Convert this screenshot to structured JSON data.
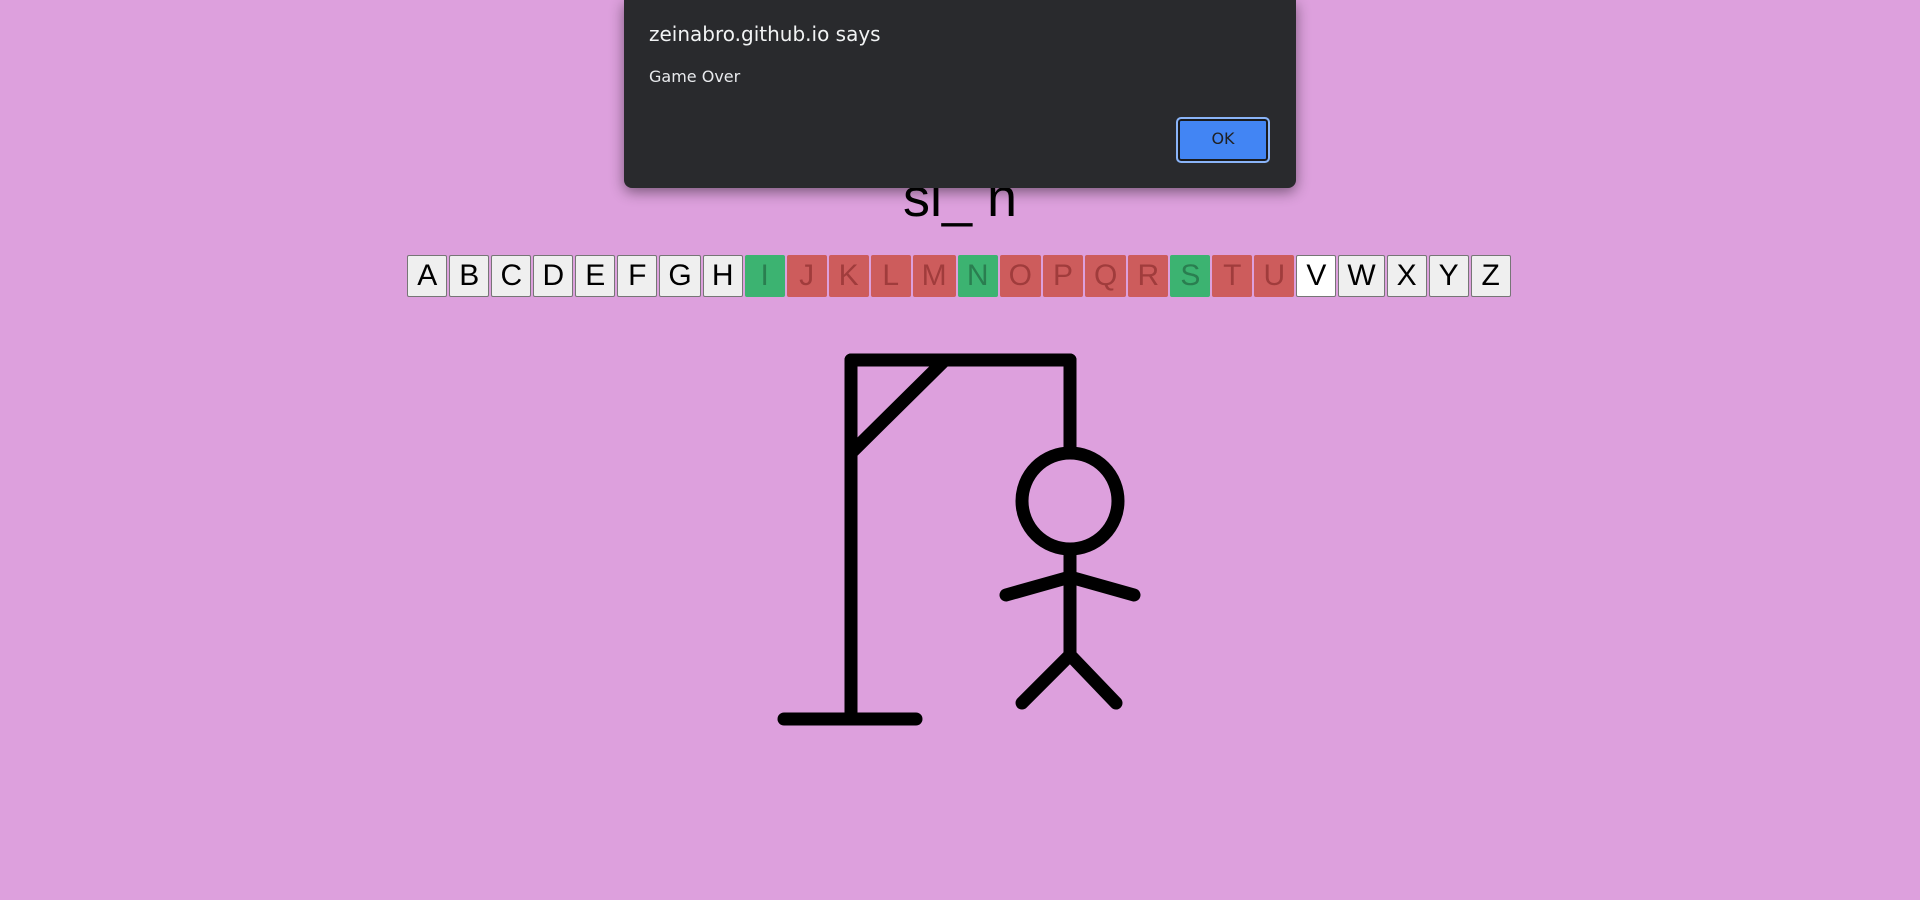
{
  "game": {
    "word_display": "sl_ n",
    "letters": [
      {
        "char": "A",
        "state": "unused"
      },
      {
        "char": "B",
        "state": "unused"
      },
      {
        "char": "C",
        "state": "unused"
      },
      {
        "char": "D",
        "state": "unused"
      },
      {
        "char": "E",
        "state": "unused"
      },
      {
        "char": "F",
        "state": "unused"
      },
      {
        "char": "G",
        "state": "unused"
      },
      {
        "char": "H",
        "state": "unused"
      },
      {
        "char": "I",
        "state": "correct"
      },
      {
        "char": "J",
        "state": "wrong"
      },
      {
        "char": "K",
        "state": "wrong"
      },
      {
        "char": "L",
        "state": "wrong"
      },
      {
        "char": "M",
        "state": "wrong"
      },
      {
        "char": "N",
        "state": "correct"
      },
      {
        "char": "O",
        "state": "wrong"
      },
      {
        "char": "P",
        "state": "wrong"
      },
      {
        "char": "Q",
        "state": "wrong"
      },
      {
        "char": "R",
        "state": "wrong"
      },
      {
        "char": "S",
        "state": "correct"
      },
      {
        "char": "T",
        "state": "wrong"
      },
      {
        "char": "U",
        "state": "wrong"
      },
      {
        "char": "V",
        "state": "unused"
      },
      {
        "char": "W",
        "state": "unused"
      },
      {
        "char": "X",
        "state": "unused"
      },
      {
        "char": "Y",
        "state": "unused"
      },
      {
        "char": "Z",
        "state": "unused"
      }
    ],
    "colors": {
      "background": "#dda0dd",
      "correct": "#3cb371",
      "wrong": "#cd5c5c",
      "drawing": "#000000"
    }
  },
  "dialog": {
    "title": "zeinabro.github.io says",
    "message": "Game Over",
    "ok_label": "OK"
  }
}
